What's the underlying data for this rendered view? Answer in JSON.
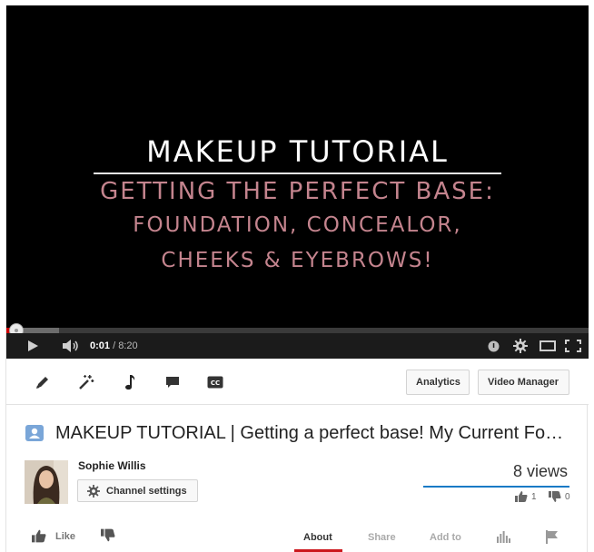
{
  "video": {
    "title_line_1": "MAKEUP TUTORIAL",
    "title_line_2": "GETTING THE PERFECT BASE:",
    "title_line_3": "FOUNDATION, CONCEALOR,",
    "title_line_4": "CHEEKS & EYEBROWS!",
    "current_time": "0:01",
    "duration": "/ 8:20",
    "buffered_fraction": 0.09,
    "played_fraction": 0.002
  },
  "toolbar": {
    "icons": [
      "pencil-icon",
      "magic-wand-icon",
      "music-note-icon",
      "comment-icon",
      "cc-icon"
    ],
    "analytics_label": "Analytics",
    "video_manager_label": "Video Manager"
  },
  "info": {
    "title": "MAKEUP TUTORIAL | Getting a perfect base! My Current Foundation Routine",
    "owner_name": "Sophie Willis",
    "channel_settings_label": "Channel settings",
    "views": "8 views",
    "likes": "1",
    "dislikes": "0"
  },
  "actions": {
    "like_label": "Like",
    "tabs": [
      {
        "label": "About",
        "active": true
      },
      {
        "label": "Share",
        "active": false
      },
      {
        "label": "Add to",
        "active": false
      }
    ]
  },
  "colors": {
    "accent_red": "#cc181e",
    "views_bar_blue": "#167ac6",
    "video_title_pink": "#c4848e"
  }
}
